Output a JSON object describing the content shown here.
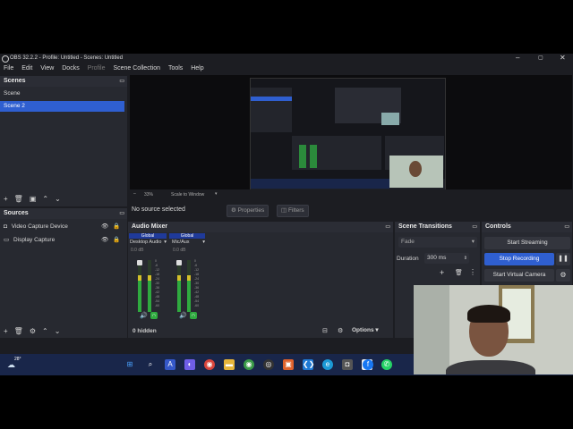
{
  "window": {
    "title": "OBS 32.2.2 - Profile: Untitled - Scenes: Untitled"
  },
  "menu": [
    "File",
    "Edit",
    "View",
    "Docks",
    "Profile",
    "Scene Collection",
    "Tools",
    "Help"
  ],
  "scenes": {
    "header": "Scenes",
    "items": [
      "Scene",
      "Scene 2"
    ],
    "selected_index": 1
  },
  "sources": {
    "header": "Sources",
    "items": [
      "Video Capture Device",
      "Display Capture"
    ]
  },
  "preview": {
    "zoom": "33%",
    "scale": "Scale to Window"
  },
  "context": {
    "no_source": "No source selected",
    "properties": "Properties",
    "filters": "Filters"
  },
  "mixer": {
    "header": "Audio Mixer",
    "channels": [
      {
        "badge": "Global",
        "name": "Desktop Audio",
        "db": "0.0 dB",
        "level": 0.7
      },
      {
        "badge": "Global",
        "name": "Mic/Aux",
        "db": "0.0 dB",
        "level": 0.7
      }
    ],
    "scale": [
      "0",
      "-6",
      "-12",
      "-18",
      "-24",
      "-30",
      "-36",
      "-42",
      "-48",
      "-54",
      "-60"
    ],
    "hidden": "0 hidden",
    "options": "Options"
  },
  "transitions": {
    "header": "Scene Transitions",
    "type": "Fade",
    "duration_label": "Duration",
    "duration": "300 ms"
  },
  "controls": {
    "header": "Controls",
    "start_streaming": "Start Streaming",
    "stop_recording": "Stop Recording",
    "start_virtual_camera": "Start Virtual Camera"
  },
  "tray": {
    "weather": "28°"
  },
  "colors": {
    "accent": "#2f5fd0",
    "stop_recording": "#2f5fd0",
    "taskbar": "#19264a"
  }
}
